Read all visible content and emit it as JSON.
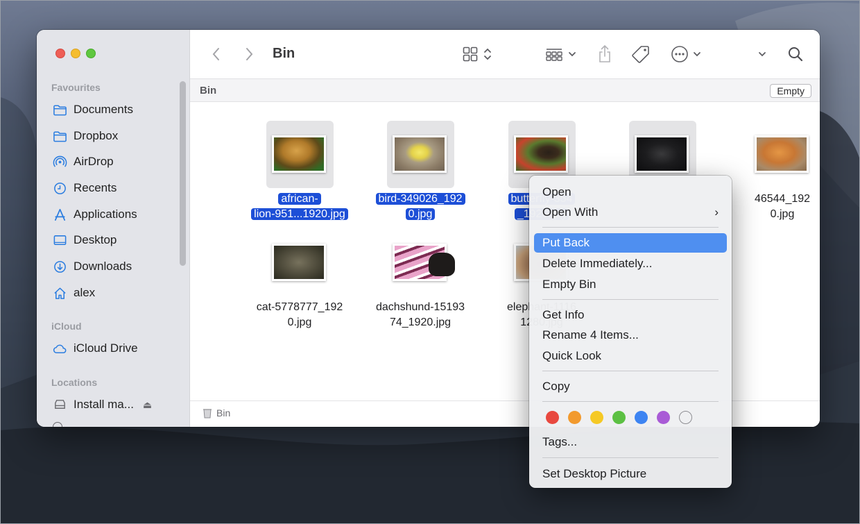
{
  "window": {
    "title": "Bin",
    "pathbar_title": "Bin",
    "empty_button": "Empty",
    "status_text": "Bin"
  },
  "sidebar": {
    "sections": [
      {
        "title": "Favourites",
        "items": [
          {
            "label": "Documents",
            "icon": "folder-icon"
          },
          {
            "label": "Dropbox",
            "icon": "folder-icon"
          },
          {
            "label": "AirDrop",
            "icon": "airdrop-icon"
          },
          {
            "label": "Recents",
            "icon": "clock-icon"
          },
          {
            "label": "Applications",
            "icon": "applications-icon"
          },
          {
            "label": "Desktop",
            "icon": "desktop-icon"
          },
          {
            "label": "Downloads",
            "icon": "download-icon"
          },
          {
            "label": "alex",
            "icon": "home-icon"
          }
        ]
      },
      {
        "title": "iCloud",
        "items": [
          {
            "label": "iCloud Drive",
            "icon": "cloud-icon"
          }
        ]
      },
      {
        "title": "Locations",
        "items": [
          {
            "label": "Install ma...",
            "icon": "disk-icon"
          }
        ]
      }
    ]
  },
  "files": [
    {
      "line1": "african-",
      "line2": "lion-951...1920.jpg",
      "selected": true
    },
    {
      "line1": "bird-349026_192",
      "line2": "0.jpg",
      "selected": true
    },
    {
      "line1": "butterfly-354",
      "line2": "_1920.jpg",
      "selected": true
    },
    {
      "line1": "",
      "line2": "",
      "selected": true
    },
    {
      "line1": "46544_192",
      "line2": "0.jpg",
      "selected": false
    },
    {
      "line1": "cat-5778777_192",
      "line2": "0.jpg",
      "selected": false
    },
    {
      "line1": "dachshund-15193",
      "line2": "74_1920.jpg",
      "selected": false
    },
    {
      "line1": "elephant-1116",
      "line2": "1280.jpg",
      "selected": false
    }
  ],
  "context_menu": {
    "items": {
      "open": "Open",
      "open_with": "Open With",
      "put_back": "Put Back",
      "delete_immediately": "Delete Immediately...",
      "empty_bin": "Empty Bin",
      "get_info": "Get Info",
      "rename": "Rename 4 Items...",
      "quick_look": "Quick Look",
      "copy": "Copy",
      "tags": "Tags...",
      "set_desktop_picture": "Set Desktop Picture"
    },
    "highlighted": "put_back",
    "submenu_chevron": "›",
    "tag_colors": [
      "#e8483f",
      "#f29a2e",
      "#f5c925",
      "#5cc043",
      "#3d84f2",
      "#a95bd6",
      "none"
    ]
  }
}
